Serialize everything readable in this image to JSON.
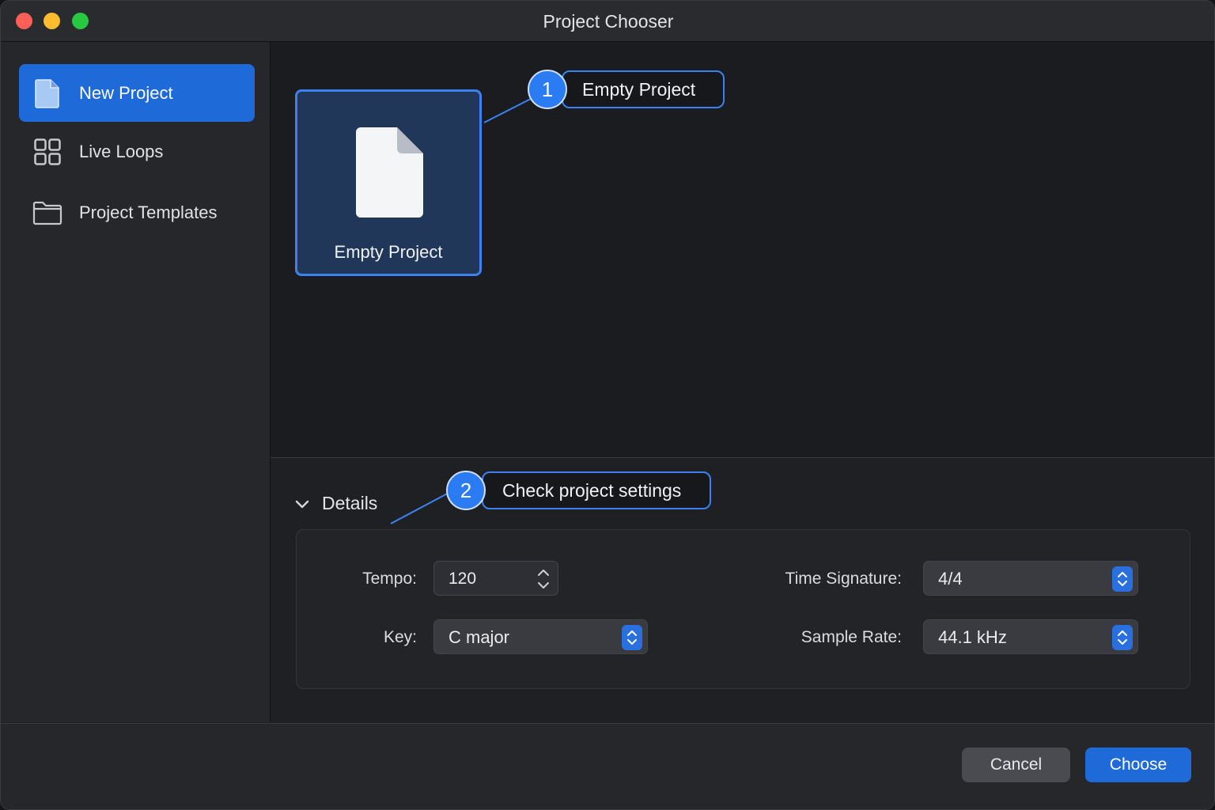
{
  "window": {
    "title": "Project Chooser"
  },
  "sidebar": {
    "items": [
      {
        "label": "New Project",
        "icon": "document-icon",
        "active": true
      },
      {
        "label": "Live Loops",
        "icon": "grid-icon",
        "active": false
      },
      {
        "label": "Project Templates",
        "icon": "folder-icon",
        "active": false
      }
    ]
  },
  "main": {
    "tiles": [
      {
        "label": "Empty Project",
        "icon": "document-icon",
        "selected": true
      }
    ]
  },
  "callouts": [
    {
      "number": "1",
      "text": "Empty Project"
    },
    {
      "number": "2",
      "text": "Check project settings"
    }
  ],
  "details": {
    "header": "Details",
    "tempo": {
      "label": "Tempo:",
      "value": "120"
    },
    "key": {
      "label": "Key:",
      "value": "C major"
    },
    "time_signature": {
      "label": "Time Signature:",
      "value": "4/4"
    },
    "sample_rate": {
      "label": "Sample Rate:",
      "value": "44.1 kHz"
    }
  },
  "footer": {
    "cancel_label": "Cancel",
    "choose_label": "Choose"
  },
  "colors": {
    "accent": "#1f6ad9",
    "callout": "#3b82f0",
    "background": "#1e1f23"
  }
}
